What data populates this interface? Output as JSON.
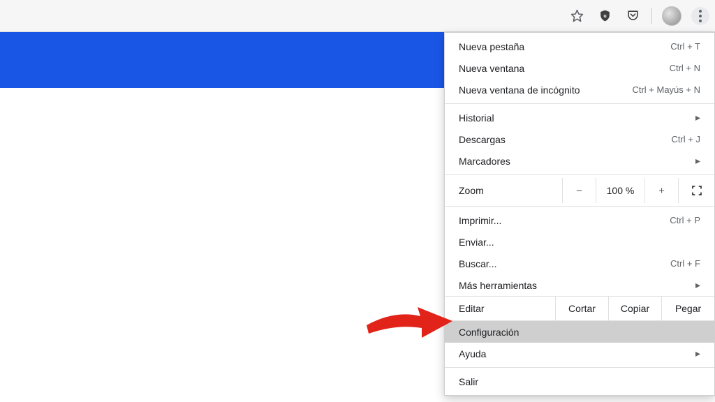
{
  "toolbar": {
    "icons": {
      "star": "star-icon",
      "shield": "ublock-icon",
      "pocket": "pocket-icon",
      "avatar": "profile-avatar",
      "menu": "kebab-menu-icon"
    }
  },
  "menu": {
    "section1": [
      {
        "label": "Nueva pestaña",
        "shortcut": "Ctrl + T"
      },
      {
        "label": "Nueva ventana",
        "shortcut": "Ctrl + N"
      },
      {
        "label": "Nueva ventana de incógnito",
        "shortcut": "Ctrl + Mayús + N"
      }
    ],
    "section2": [
      {
        "label": "Historial",
        "submenu": true
      },
      {
        "label": "Descargas",
        "shortcut": "Ctrl + J"
      },
      {
        "label": "Marcadores",
        "submenu": true
      }
    ],
    "zoom": {
      "label": "Zoom",
      "minus": "−",
      "value": "100 %",
      "plus": "+"
    },
    "section3": [
      {
        "label": "Imprimir...",
        "shortcut": "Ctrl + P"
      },
      {
        "label": "Enviar..."
      },
      {
        "label": "Buscar...",
        "shortcut": "Ctrl + F"
      },
      {
        "label": "Más herramientas",
        "submenu": true
      }
    ],
    "edit": {
      "label": "Editar",
      "cut": "Cortar",
      "copy": "Copiar",
      "paste": "Pegar"
    },
    "section4": [
      {
        "label": "Configuración",
        "highlighted": true
      },
      {
        "label": "Ayuda",
        "submenu": true
      }
    ],
    "section5": [
      {
        "label": "Salir"
      }
    ]
  },
  "annotation": {
    "arrow_color": "#e2231a"
  }
}
